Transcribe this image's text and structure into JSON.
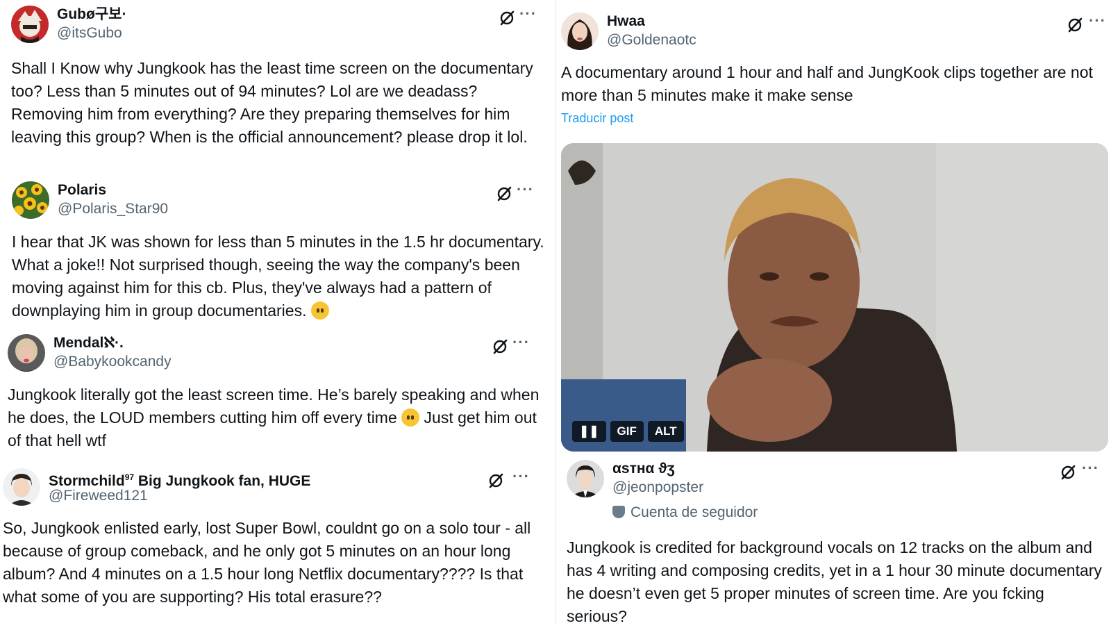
{
  "tweets": [
    {
      "name": "Gubø구보·",
      "handle": "@itsGubo",
      "text": "Shall I Know why Jungkook has the least time screen on the documentary too? Less than 5 minutes out of 94 minutes? Lol are we deadass? Removing him from everything? Are they preparing themselves for him leaving this group? When is the official announcement? please drop it lol."
    },
    {
      "name": "Polaris",
      "handle": "@Polaris_Star90",
      "text": "I hear that JK was shown for less than 5 minutes in the 1.5 hr documentary. What a joke!! Not surprised though, seeing the way the company's been moving against him for this cb. Plus, they've always had a pattern of downplaying him in group documentaries."
    },
    {
      "name": "Mendalℵ·.",
      "handle": "@Babykookcandy",
      "text_a": "Jungkook literally got the least screen time. He’s barely speaking and when he does, the LOUD members cutting him off every time",
      "text_b": "Just get him out of that hell wtf"
    },
    {
      "name": "Stormchild",
      "name_sup": "97",
      "name_rest": " Big Jungkook fan, HUGE",
      "handle": "@Fireweed121",
      "text": "So, Jungkook enlisted early, lost Super Bowl, couldnt go on a solo tour - all because of group comeback, and he only got 5 minutes on an hour long album? And 4 minutes on a 1.5 hour long Netflix documentary???? Is that what some of you are supporting? His total erasure??"
    },
    {
      "name": "Hwaa",
      "handle": "@Goldenaotc",
      "text": "A documentary around 1 hour and half and JungKook clips together are not more than 5 minutes make it make sense",
      "translate": "Traducir post",
      "media": {
        "gif_label": "GIF",
        "alt_label": "ALT",
        "pause_icon": "pause-icon"
      }
    },
    {
      "name": "αѕтнα ϑʒ",
      "handle": "@jeonpopster",
      "badge": "Cuenta de seguidor",
      "text": "Jungkook is credited for background vocals on 12 tracks on the album and has 4 writing and composing credits, yet in a 1 hour 30 minute documentary he doesn’t even get 5 proper minutes of screen time. Are you fcking serious?"
    }
  ],
  "icons": {
    "grok": "grok-slash-icon",
    "more": "more-dots-icon",
    "more_glyph": "···"
  },
  "colors": {
    "handle": "#536471",
    "link": "#1d9bf0",
    "text": "#0f1419"
  }
}
